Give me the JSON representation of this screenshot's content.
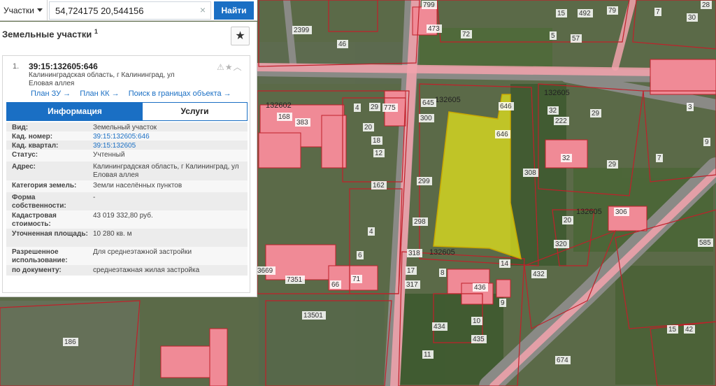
{
  "search": {
    "type_label": "Участки",
    "query": "54,724175 20,544156",
    "clear_symbol": "×",
    "find_label": "Найти"
  },
  "panel": {
    "title": "Земельные участки",
    "title_count": "1",
    "star_icon": "star-icon"
  },
  "result": {
    "index": "1.",
    "kad_number": "39:15:132605:646",
    "address": "Калининградская область, г Калининград, ул Еловая аллея",
    "tool_icons": [
      "warning-icon",
      "star-icon",
      "chevron-up-icon"
    ],
    "links": [
      "План ЗУ →",
      "План КК →",
      "Поиск в границах объекта →"
    ]
  },
  "tabs": [
    "Информация",
    "Услуги"
  ],
  "info": [
    {
      "label": "Вид:",
      "value": "Земельный участок"
    },
    {
      "label": "Кад. номер:",
      "value": "39:15:132605:646",
      "link": true
    },
    {
      "label": "Кад. квартал:",
      "value": "39:15:132605",
      "link": true
    },
    {
      "label": "Статус:",
      "value": "Учтенный"
    },
    {
      "label": "Адрес:",
      "value": "Калининградская область, г Калининград, ул Еловая аллея"
    },
    {
      "label": "Категория земель:",
      "value": "Земли населённых пунктов"
    },
    {
      "label": "Форма собственности:",
      "value": "-"
    },
    {
      "label": "Кадастровая стоимость:",
      "value": "43 019 332,80 руб."
    },
    {
      "label": "Уточненная площадь:",
      "value": "10 280 кв. м"
    },
    {
      "label": "Разрешенное использование:",
      "value": "Для среднеэтажной застройки"
    },
    {
      "label": "по документу:",
      "value": "среднеэтажная жилая застройка"
    }
  ],
  "map": {
    "colors": {
      "imagery": "#5b6a48",
      "parcel_border": "#c0202a",
      "building_fill": "#f08a96",
      "selected_fill": "#e8e81a"
    },
    "quarters": [
      "132605",
      "132602",
      "132605",
      "132605",
      "132605"
    ],
    "parcel_numbers": [
      "799",
      "15",
      "492",
      "79",
      "7",
      "2399",
      "72",
      "46",
      "5",
      "57",
      "473",
      "645",
      "646",
      "775",
      "29",
      "4",
      "168",
      "383",
      "20",
      "18",
      "12",
      "300",
      "646",
      "32",
      "29",
      "7",
      "222",
      "162",
      "299",
      "306",
      "298",
      "4",
      "320",
      "318",
      "17",
      "6",
      "432",
      "3669",
      "7351",
      "66",
      "71",
      "8",
      "436",
      "9",
      "14",
      "317",
      "13501",
      "186",
      "10",
      "434",
      "435",
      "11",
      "674",
      "15",
      "42",
      "585",
      "28",
      "32",
      "3",
      "9",
      "30",
      "20",
      "29",
      "308"
    ]
  }
}
